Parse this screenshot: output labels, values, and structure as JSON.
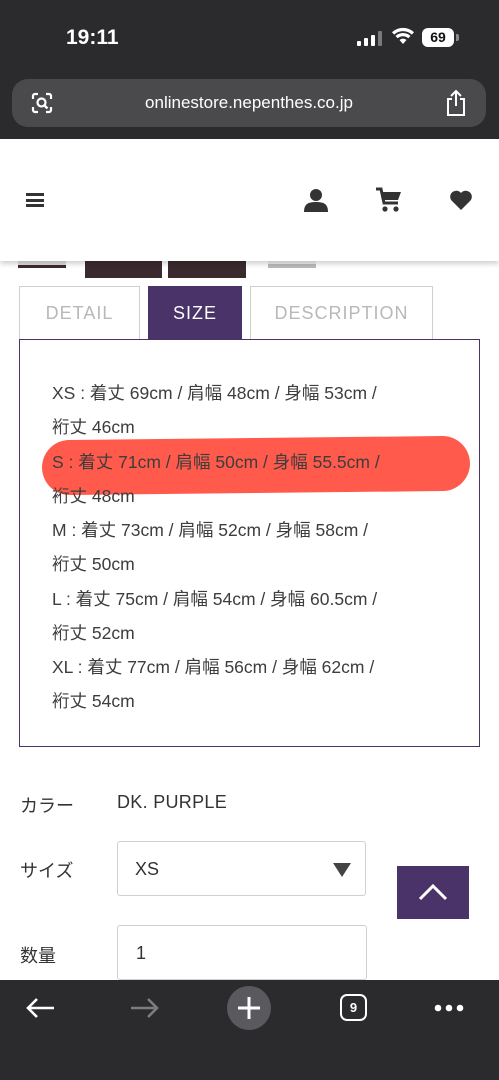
{
  "status_bar": {
    "time": "19:11",
    "battery": "69"
  },
  "browser": {
    "url": "onlinestore.nepenthes.co.jp",
    "tab_count": "9"
  },
  "tabs": [
    {
      "label": "DETAIL",
      "active": false
    },
    {
      "label": "SIZE",
      "active": true
    },
    {
      "label": "DESCRIPTION",
      "active": false
    }
  ],
  "size_table": {
    "lines": [
      "XS : 着丈 69cm / 肩幅 48cm / 身幅 53cm /",
      "裄丈 46cm",
      "S : 着丈 71cm / 肩幅 50cm / 身幅 55.5cm /",
      "裄丈 48cm",
      "M : 着丈 73cm / 肩幅 52cm / 身幅 58cm /",
      "裄丈 50cm",
      "L : 着丈 75cm / 肩幅 54cm / 身幅 60.5cm /",
      "裄丈 52cm",
      "XL : 着丈 77cm / 肩幅 56cm / 身幅 62cm /",
      "裄丈 54cm"
    ],
    "highlighted_size": "S"
  },
  "options": {
    "color_label": "カラー",
    "color_value": "DK. PURPLE",
    "size_label": "サイズ",
    "size_value": "XS",
    "qty_label": "数量",
    "qty_value": "1"
  },
  "colors": {
    "brand_purple": "#4a3368",
    "highlight_red": "#ff5a4c",
    "browser_chrome": "#2b2b2d"
  },
  "icons": [
    "lens-icon",
    "share-icon",
    "hamburger-icon",
    "user-icon",
    "cart-icon",
    "heart-icon",
    "back-arrow-icon",
    "forward-arrow-icon",
    "new-tab-plus-icon",
    "more-icon",
    "chevron-up-icon",
    "dropdown-arrow-icon"
  ]
}
